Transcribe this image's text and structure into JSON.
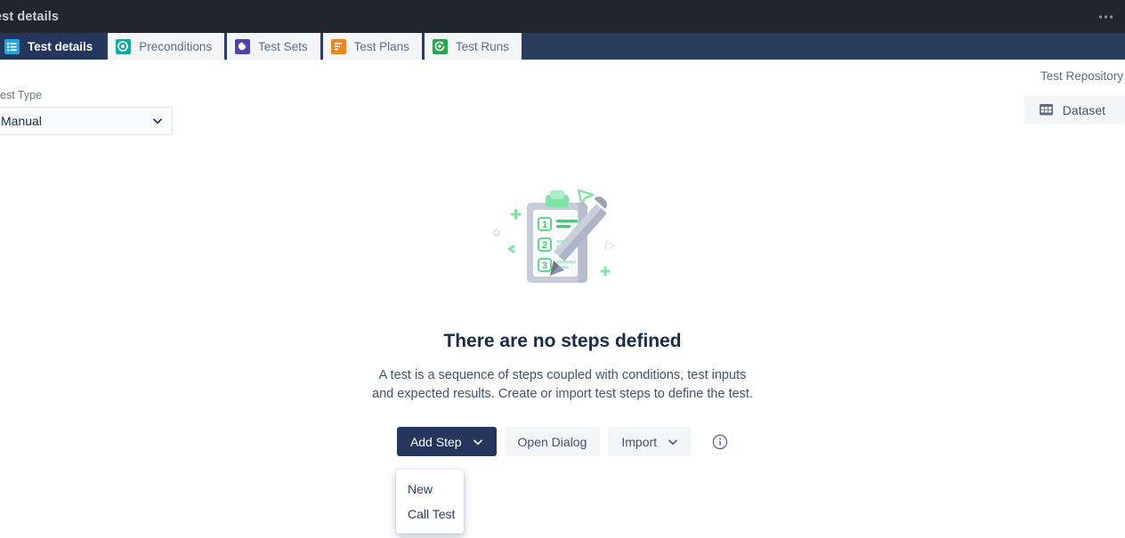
{
  "topbar": {
    "title": "est details",
    "menu_icon": "ellipsis-icon"
  },
  "tabs": [
    {
      "label": "Test details",
      "icon": "list-icon",
      "active": true
    },
    {
      "label": "Preconditions",
      "icon": "precondition-icon",
      "active": false
    },
    {
      "label": "Test Sets",
      "icon": "test-set-icon",
      "active": false
    },
    {
      "label": "Test Plans",
      "icon": "test-plan-icon",
      "active": false
    },
    {
      "label": "Test Runs",
      "icon": "test-run-icon",
      "active": false
    }
  ],
  "test_type": {
    "label": "est Type",
    "value": "Manual",
    "chevron_icon": "chevron-down-icon"
  },
  "repository": {
    "label": "Test Repository",
    "dataset_button": "Dataset",
    "dataset_icon": "grid-icon"
  },
  "empty_state": {
    "illustration": "clipboard-steps-illustration",
    "step_numbers": [
      "1",
      "2",
      "3"
    ],
    "title": "There are no steps defined",
    "description": "A test is a sequence of steps coupled with conditions, test inputs and expected results. Create or import test steps to define the test.",
    "buttons": {
      "add_step": "Add Step",
      "open_dialog": "Open Dialog",
      "import": "Import"
    },
    "info_icon": "info-icon"
  },
  "dropdown": {
    "items": [
      {
        "label": "New"
      },
      {
        "label": "Call Test"
      }
    ]
  },
  "colors": {
    "topbar_bg": "#21262d",
    "tabstrip_bg": "#2b3d5e",
    "active_tab_bg": "#24365c",
    "primary_button_bg": "#24365c",
    "text_dark": "#172b4d",
    "text_muted": "#5e6c84",
    "neutral_button_bg": "#f4f5f7",
    "accent_green": "#6ddf9a",
    "accent_cyan": "#1ca7e0"
  }
}
